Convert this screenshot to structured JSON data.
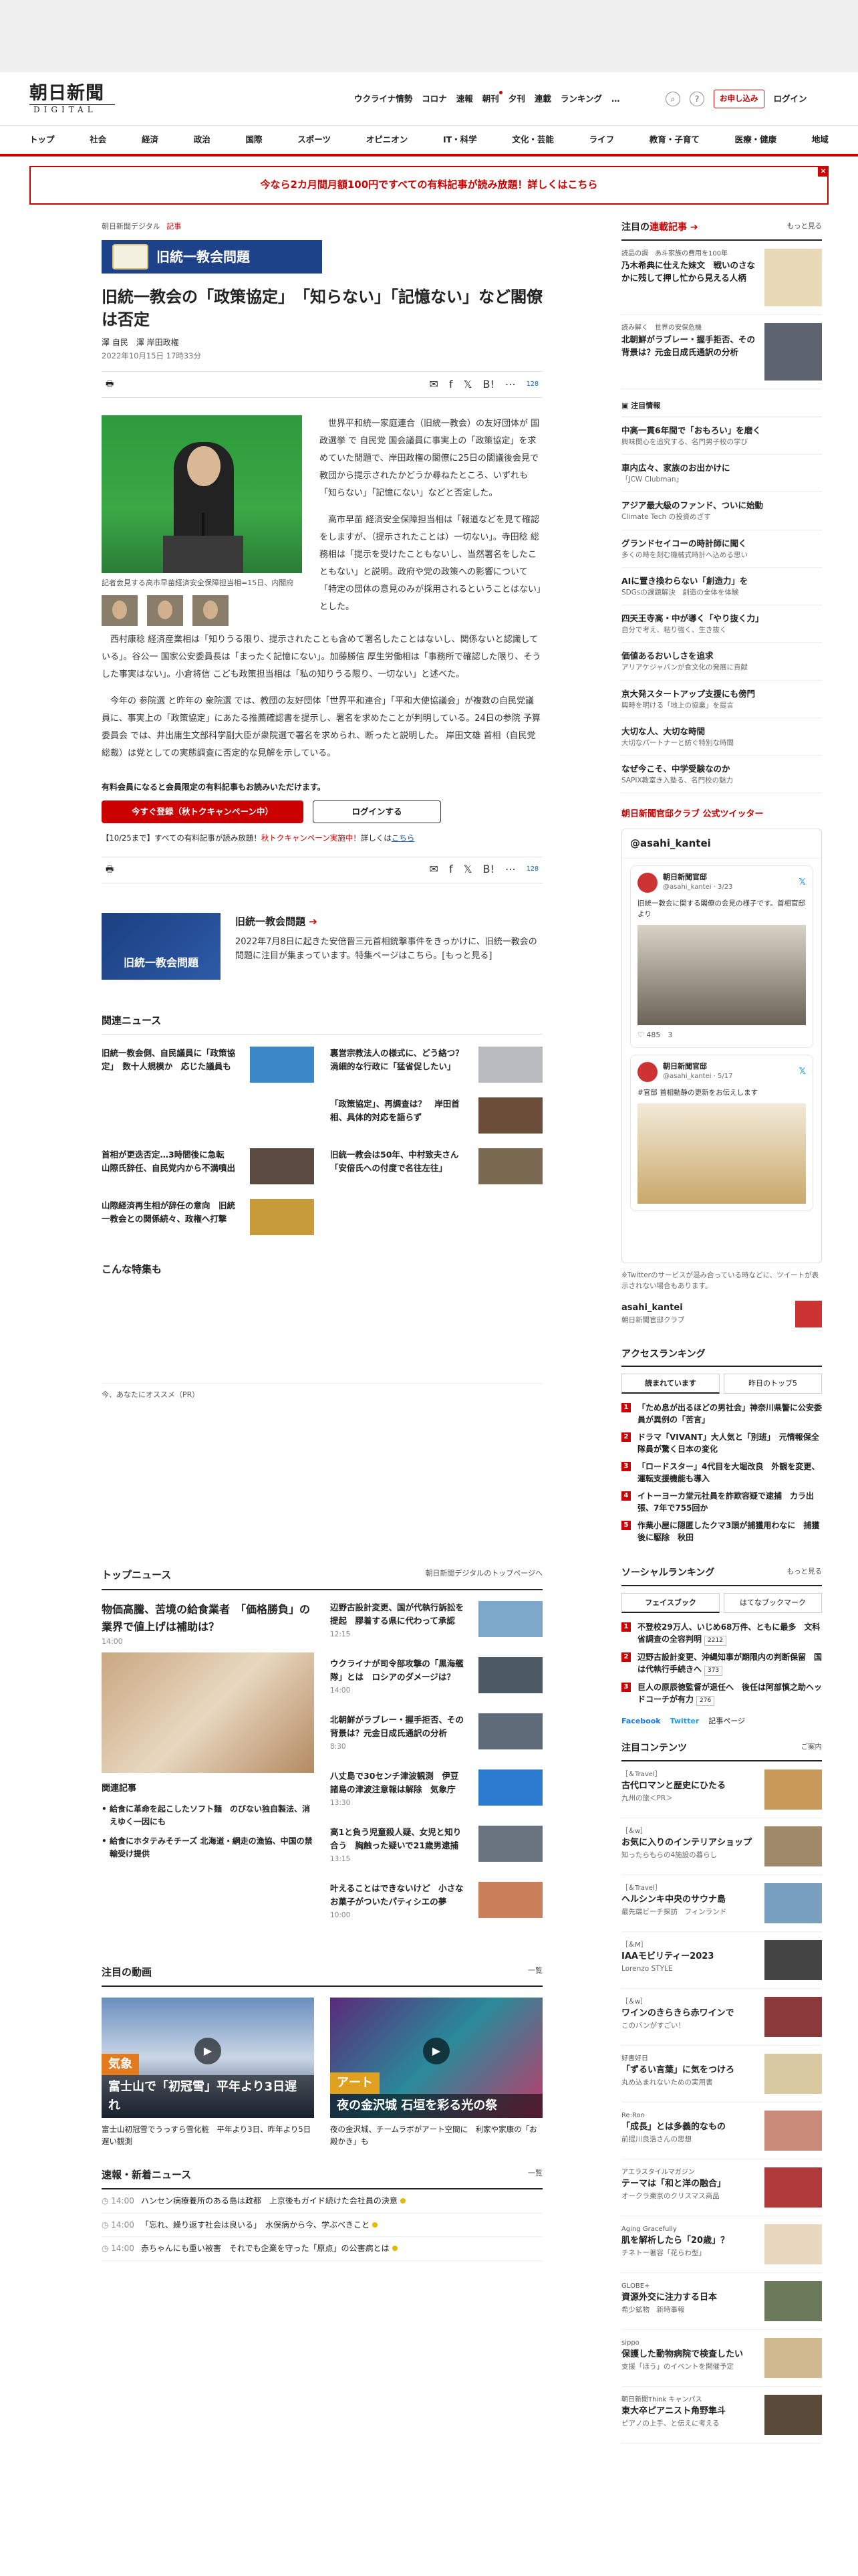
{
  "header": {
    "logo_main": "朝日新聞",
    "logo_sub": "DIGITAL",
    "nav": [
      "ウクライナ情勢",
      "コロナ",
      "速報",
      "朝刊",
      "夕刊",
      "連載",
      "ランキング",
      "…"
    ],
    "register": "お申し込み",
    "login": "ログイン"
  },
  "gnav": [
    "トップ",
    "社会",
    "経済",
    "政治",
    "国際",
    "スポーツ",
    "オピニオン",
    "IT・科学",
    "文化・芸能",
    "ライフ",
    "教育・子育て",
    "医療・健康",
    "地域"
  ],
  "banner": {
    "text": "今なら2カ月間月額100円ですべての有料記事が読み放題！詳しくはこちら",
    "close": "×"
  },
  "article": {
    "crumb_site": "朝日新聞デジタル",
    "crumb_kind": "記事",
    "series": "旧統一教会問題",
    "title": "旧統一教会の「政策協定」　「知らない」「記憶ない」など閣僚は否定",
    "authors": "澤 自民　澤 岸田政権",
    "date": "2022年10月15日 17時33分",
    "share": {
      "listen": "list",
      "count": "128"
    },
    "photo_caption": "記者会見する高市早苗経済安全保障担当相=15日、内閣府",
    "paragraphs": [
      "世界平和統一家庭連合（旧統一教会）の友好団体が 国政選挙 で 自民党 国会議員に事実上の「政策協定」を求めていた問題で、岸田政権の閣僚に25日の閣議後会見で教団から提示されたかどうか尋ねたところ、いずれも「知らない」「記憶にない」などと否定した。",
      "高市早苗 経済安全保障担当相は「報道などを見て確認をしますが、（提示されたことは）一切ない」。寺田稔 総務相は「提示を受けたこともないし、当然署名をしたこともない」と説明。政府や党の政策への影響について「特定の団体の意見のみが採用されるということはない」とした。",
      "西村康稔 経済産業相は「知りうる限り、提示されたことも含めて署名したことはないし、関係ないと認識している」。谷公一 国家公安委員長は「まったく記憶にない」。加藤勝信 厚生労働相は「事務所で確認した限り、そうした事実はない」。小倉将信 こども政策担当相は「私の知りうる限り、一切ない」と述べた。",
      "今年の 参院選 と昨年の 衆院選 では、教団の友好団体「世界平和連合」「平和大使協議会」が複数の自民党議員に、事実上の「政策協定」にあたる推薦確認書を提示し、署名を求めたことが判明している。24日の参院 予算委員会 では、井出庸生文部科学副大臣が衆院選で署名を求められ、断ったと説明した。 岸田文雄 首相（自民党総裁）は党としての実態調査に否定的な見解を示している。"
    ],
    "member_note": "有料会員になると会員限定の有料記事もお読みいただけます。",
    "register_btn": "今すぐ登録（秋トクキャンペーン中）",
    "login_btn": "ログインする",
    "campaign_prefix": "【10/25まで】すべての有料記事が読み放題！",
    "campaign_red": "秋トクキャンペーン実施中！",
    "campaign_mid": "詳しくは",
    "campaign_link": "こちら"
  },
  "promo": {
    "img_label": "旧統一教会問題",
    "title": "旧統一教会問題",
    "text": "2022年7月8日に起きた安倍晋三元首相銃撃事件をきっかけに、旧統一教会の問題に注目が集まっています。特集ページはこちら。[もっと見る]"
  },
  "related": {
    "heading": "関連ニュース",
    "items": [
      "旧統一教会側、自民議員に「政策協定」　数十人規模か　応じた議員も",
      "裏営宗教法人の様式に、どう絡つ？　渦細的な行政に「猛省促したい」",
      "",
      "「政策協定」、再調査は？　岸田首相、具体的対応を語らず",
      "首相が更迭否定…3時間後に急転　山際氏辞任、自民党内から不満噴出",
      "旧統一教会は50年、中村致夫さん「安倍氏への付度で名往左往」",
      "山際経済再生相が辞任の意向　旧統一教会との関係続々、政権へ打撃",
      ""
    ]
  },
  "special_heading": "こんな特集も",
  "reco_label": "今、あなたにオススメ（PR）",
  "topnews": {
    "heading": "トップニュース",
    "more": "朝日新聞デジタルのトップページへ",
    "lead_title": "物価高騰、苦境の給食業者　「価格勝負」の業界で値上げは補助は？",
    "lead_time": "14:00",
    "related_heading": "関連記事",
    "related_items": [
      "給食に革命を起こしたソフト麺　のびない独自製法、消えゆく一因にも",
      "給食にホタテみそチーズ 北海道・網走の漁協、中国の禁輸受け提供"
    ],
    "items": [
      {
        "t": "辺野古設計変更、国が代執行訴訟を提起　膠着する県に代わって承認",
        "tm": "12:15"
      },
      {
        "t": "ウクライナが司令部攻撃の「黒海艦隊」とは　ロシアのダメージは？",
        "tm": "14:00"
      },
      {
        "t": "北朝鮮がラブレー・握手拒否、その背景は？元金日成氏通訳の分析",
        "tm": "8:30"
      },
      {
        "t": "八丈島で30センチ津波観測　伊豆諸島の津波注意報は解除　気象庁",
        "tm": "13:30"
      },
      {
        "t": "高1と負う児童殺人疑、女児と知り合う　胸触った疑いで21歳男逮捕",
        "tm": "13:15"
      },
      {
        "t": "叶えることはできないけど　小さなお菓子がついたパティシエの夢",
        "tm": "10:00"
      }
    ]
  },
  "videos": {
    "heading": "注目の動画",
    "more": "一覧",
    "items": [
      {
        "tag": "気象",
        "band": "富士山で「初冠雪」平年より3日遅れ",
        "cap": "富士山初冠雪でうっすら雪化粧　平年より3日、昨年より5日遅い観測"
      },
      {
        "tag": "アート",
        "band": "夜の金沢城 石垣を彩る光の祭",
        "cap": "夜の金沢城、チームラボがアート空間に　利家や家康の「お殿かき」も"
      }
    ]
  },
  "breaking": {
    "heading": "速報・新着ニュース",
    "more": "一覧",
    "items": [
      {
        "tm": "14:00",
        "t": "ハンセン病療養所のある島は政都　上京後もガイド続けた会社員の決意"
      },
      {
        "tm": "14:00",
        "t": "「忘れ、繰り返す社会は良いる」　水俣病から今、学ぶべきこと"
      },
      {
        "tm": "14:00",
        "t": "赤ちゃんにも重い被害　それでも企業を守った「原点」の公害病とは"
      }
    ]
  },
  "side": {
    "series_heading_prefix": "注目の",
    "series_heading": "連載記事",
    "more": "もっと見る",
    "series_items": [
      {
        "l": "読品の調　あ斗家族の費用を100年",
        "t": "乃木希典に仕えた妹文　戦いのさなかに残して押し忙から見える人柄"
      },
      {
        "l": "読み解く　世界の安保危機",
        "t": "北朝鮮がラブレー・握手拒否、その背景は？元金日成氏通訳の分析"
      }
    ],
    "attention_label": "注目情報",
    "attention_items": [
      {
        "t": "中高一貫6年間で「おもろい」を磨く",
        "s": "興味関心を追究する、名門男子校の学び"
      },
      {
        "t": "車内広々、家族のお出かけに",
        "s": "「JCW Clubman」"
      },
      {
        "t": "アジア最大級のファンド、ついに始動",
        "s": "Climate Tech の投資めざす"
      },
      {
        "t": "グランドセイコーの時計師に聞く",
        "s": "多くの時を刻む機械式時計へ込める思い"
      },
      {
        "t": "AIに置き換わらない「創造力」を",
        "s": "SDGsの課題解決　創造の全体を体験"
      },
      {
        "t": "四天王寺高・中が導く「やり抜く力」",
        "s": "自分で考え、粘り強く、生き抜く"
      },
      {
        "t": "価値あるおいしさを追求",
        "s": "アリアケジャパンが食文化の発展に貢献"
      },
      {
        "t": "京大発スタートアップ支援にも傍門",
        "s": "興時を明ける「地上の協業」を提言"
      },
      {
        "t": "大切な人、大切な時間",
        "s": "大切なパートナーと紡ぐ特別な時間"
      },
      {
        "t": "なぜ今こそ、中学受験なのか",
        "s": "SAPIX教室き入塾る、名門校の魅力"
      }
    ],
    "twitter_heading": "朝日新聞官邸クラブ 公式ツイッター",
    "twitter_box_title": "@asahi_kantei",
    "tweets": [
      {
        "name": "朝日新聞官邸",
        "handle": "@asahi_kantei · 3/23",
        "body": "旧統一教会に関する閣僚の会見の様子です。首相官邸より",
        "stats": "485　3"
      },
      {
        "name": "朝日新聞官邸",
        "handle": "@asahi_kantei · 5/17",
        "body": "#官邸 首相動静の更新をお伝えします",
        "stats": ""
      }
    ],
    "twitter_note": "※Twitterのサービスが混み合っている時などに、ツイートが表示されない場合もあります。",
    "twitter_account": "asahi_kantei",
    "twitter_account_sub": "朝日新聞官邸クラブ",
    "access_heading": "アクセスランキング",
    "access_tabs": [
      "読まれています",
      "昨日のトップ5"
    ],
    "access_items": [
      "「ため息が出るほどの男社会」神奈川県警に公安委員が異例の「苦言」",
      "ドラマ「VIVANT」大人気と「別班」　元情報保全隊員が驚く日本の変化",
      "「ロードスター」4代目を大堀改良　外観を変更、運転支援機能も導入",
      "イトーヨーカ堂元社員を詐欺容疑で逮捕　カラ出張、7年で755回か",
      "作業小屋に隠匿したクマ3頭が捕獲用わなに　捕獲後に駆除　秋田"
    ],
    "social_heading": "ソーシャルランキング",
    "social_tabs": [
      "フェイスブック",
      "はてなブックマーク"
    ],
    "social_items": [
      {
        "t": "不登校29万人、いじめ68万件、ともに最多　文科省調査の全容判明",
        "c": "2212"
      },
      {
        "t": "辺野古設計変更、沖縄知事が期限内の判断保留　国は代執行手続きへ",
        "c": "373"
      },
      {
        "t": "巨人の原辰徳監督が退任へ　後任は阿部慎之助ヘッドコーチが有力",
        "c": "276"
      }
    ],
    "social_fb": "Facebook",
    "social_tw": "Twitter",
    "social_more": "記事ページ",
    "contents_heading": "注目コンテンツ",
    "contents_more": "ご案内",
    "contents_items": [
      {
        "l": "［＆Travel］",
        "t": "古代ロマンと歴史にひたる",
        "s": "九州の旅＜PR＞"
      },
      {
        "l": "［＆w］",
        "t": "お気に入りのインテリアショップ",
        "s": "知ったらもらの4施設の暮らし"
      },
      {
        "l": "［＆Travel］",
        "t": "ヘルシンキ中央のサウナ島",
        "s": "最先端ビーチ探訪　フィンランド"
      },
      {
        "l": "［＆M］",
        "t": "IAAモビリティー2023",
        "s": "Lorenzo STYLE"
      },
      {
        "l": "［＆w］",
        "t": "ワインのきらきら赤ワインで",
        "s": "このバンがすごい！"
      },
      {
        "l": "好書好日",
        "t": "「ずるい言葉」に気をつけろ",
        "s": "丸め込まれないための実用書"
      },
      {
        "l": "Re:Ron",
        "t": "「成長」とは多義的なもの",
        "s": "前提川良浩さんの思想"
      },
      {
        "l": "アエラスタイルマガジン",
        "t": "テーマは「和と洋の融合」",
        "s": "オークラ東京のクリスマス商品"
      },
      {
        "l": "Aging Gracefully",
        "t": "肌を解析したら「20歳」？",
        "s": "チネトー著容「花らわ型」"
      },
      {
        "l": "GLOBE+",
        "t": "資源外交に注力する日本",
        "s": "希少鉱物　新時事報"
      },
      {
        "l": "sippo",
        "t": "保護した動物病院で検査したい",
        "s": "支援「ほう」のイベントを開催予定"
      },
      {
        "l": "朝日新聞Think キャンパス",
        "t": "東大卒ピアニスト角野隼斗",
        "s": "ピアノの上手、と伝えに考える"
      }
    ]
  }
}
